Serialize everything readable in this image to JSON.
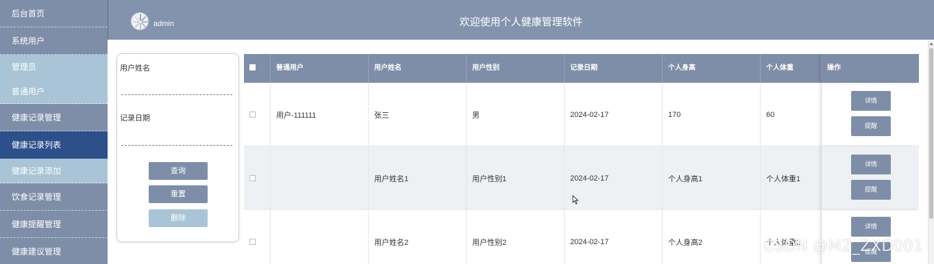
{
  "sidebar": {
    "items": [
      {
        "label": "后台首页"
      },
      {
        "label": "系统用户"
      },
      {
        "label": "管理员"
      },
      {
        "label": "普通用户"
      },
      {
        "label": "健康记录管理"
      },
      {
        "label": "健康记录列表"
      },
      {
        "label": "健康记录添加"
      },
      {
        "label": "饮食记录管理"
      },
      {
        "label": "健康提醒管理"
      },
      {
        "label": "健康建议管理"
      }
    ]
  },
  "header": {
    "username": "admin",
    "title": "欢迎使用个人健康管理软件"
  },
  "search": {
    "name_label": "用户姓名",
    "date_label": "记录日期",
    "query_label": "查询",
    "reset_label": "重置",
    "delete_label": "删除"
  },
  "table": {
    "columns": [
      "普通用户",
      "用户姓名",
      "用户性别",
      "记录日期",
      "个人身高",
      "个人体重",
      "操作"
    ],
    "rows": [
      {
        "user": "用户-111111",
        "name": "张三",
        "gender": "男",
        "date": "2024-02-17",
        "height": "170",
        "weight": "60"
      },
      {
        "user": "",
        "name": "用户姓名1",
        "gender": "用户性别1",
        "date": "2024-02-17",
        "height": "个人身高1",
        "weight": "个人体重1"
      },
      {
        "user": "",
        "name": "用户姓名2",
        "gender": "用户性别2",
        "date": "2024-02-17",
        "height": "个人身高2",
        "weight": "个人体重2"
      }
    ],
    "detail_label": "详情",
    "remind_label": "提醒"
  },
  "watermark": "CSDN @MZ_ZXD001",
  "colors": {
    "sidebar": "#7f8ea8",
    "sidebar_sub": "#a9c4d6",
    "sidebar_active": "#2d4f8a",
    "header": "#8493ad",
    "button": "#7f8ea8"
  }
}
